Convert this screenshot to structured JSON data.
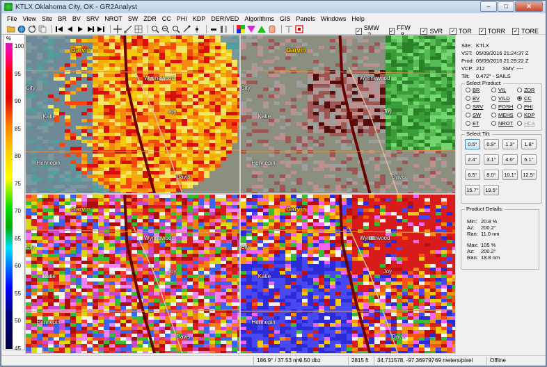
{
  "window": {
    "title": "KTLX Oklahoma City, OK - GR2Analyst",
    "minimize": "–",
    "maximize": "□",
    "close": "✕"
  },
  "menu": [
    "File",
    "View",
    "Site",
    "BR",
    "BV",
    "SRV",
    "NROT",
    "SW",
    "ZDR",
    "CC",
    "PHI",
    "KDP",
    "DERIVED",
    "Algorithms",
    "GIS",
    "Panels",
    "Windows",
    "Help"
  ],
  "warnings": [
    {
      "label": "SMW - 2",
      "checked": true
    },
    {
      "label": "FFW - 8",
      "checked": true
    },
    {
      "label": "SVR",
      "checked": true
    },
    {
      "label": "TOR",
      "checked": true
    },
    {
      "label": "TORR",
      "checked": true
    },
    {
      "label": "TORE",
      "checked": true
    }
  ],
  "colorbar": {
    "unit": "%",
    "ticks": [
      "100",
      "95",
      "90",
      "85",
      "80",
      "75",
      "70",
      "65",
      "60",
      "55",
      "50",
      "45"
    ]
  },
  "map_labels": {
    "garvin": "Garvin",
    "wynnewood": "Wynnewood",
    "city": "City",
    "katie": "Katie",
    "joy": "Joy",
    "hennepin": "Hennepin",
    "davis": "Davis"
  },
  "site": {
    "site_k": "Site:",
    "site_v": "KTLX",
    "vst_k": "VST:",
    "vst_v": "05/09/2016  21:24:37 Z",
    "prod_k": "Prod:",
    "prod_v": "05/09/2016  21:29:22 Z",
    "vcp_k": "VCP:",
    "vcp_v": "212",
    "smv_k": "SMV:",
    "smv_v": "----",
    "tilt_k": "Tilt:",
    "tilt_v": "0.472° - SAILS"
  },
  "product_group": "Select Product:",
  "products": [
    {
      "label": "BR",
      "on": false,
      "dis": false
    },
    {
      "label": "VIL",
      "on": false,
      "dis": false
    },
    {
      "label": "ZDR",
      "on": false,
      "dis": false
    },
    {
      "label": "BV",
      "on": false,
      "dis": false
    },
    {
      "label": "VILD",
      "on": false,
      "dis": false
    },
    {
      "label": "CC",
      "on": true,
      "dis": false
    },
    {
      "label": "SRV",
      "on": false,
      "dis": false
    },
    {
      "label": "POSH",
      "on": false,
      "dis": false
    },
    {
      "label": "PHI",
      "on": false,
      "dis": false
    },
    {
      "label": "SW",
      "on": false,
      "dis": false
    },
    {
      "label": "MEHS",
      "on": false,
      "dis": false
    },
    {
      "label": "KDP",
      "on": false,
      "dis": false
    },
    {
      "label": "ET",
      "on": false,
      "dis": false
    },
    {
      "label": "NROT",
      "on": false,
      "dis": false
    },
    {
      "label": "HCA",
      "on": false,
      "dis": true
    }
  ],
  "tilt_group": "Select Tilt:",
  "tilts": [
    "0.5°",
    "0.9°",
    "1.3°",
    "1.8°",
    "2.4°",
    "3.1°",
    "4.0°",
    "5.1°",
    "6.5°",
    "8.0°",
    "10.1°",
    "12.5°",
    "15.7°",
    "19.5°"
  ],
  "selected_tilt": "0.5°",
  "details_group": "Product Details:",
  "details": {
    "min_k": "Min:",
    "min_v": "20.8 %",
    "az1_k": "Az:",
    "az1_v": "200.2°",
    "ran1_k": "Ran:",
    "ran1_v": "11.0 nm",
    "max_k": "Max:",
    "max_v": "105 %",
    "az2_k": "Az:",
    "az2_v": "200.2°",
    "ran2_k": "Ran:",
    "ran2_v": "18.8 nm"
  },
  "status": {
    "azran": "186.9° / 37.53 nm",
    "value": "0.50 dbz",
    "height": "2815 ft",
    "coords": "34.711578, -97.369797",
    "scale": "69 meters/pixel",
    "conn": "Offline"
  }
}
